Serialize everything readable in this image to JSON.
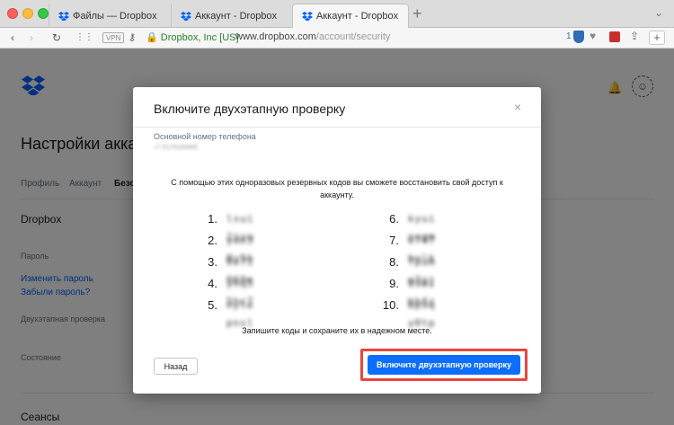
{
  "browser": {
    "tabs": [
      {
        "title": "Файлы — Dropbox"
      },
      {
        "title": "Аккаунт - Dropbox"
      },
      {
        "title": "Аккаунт - Dropbox"
      }
    ],
    "new_tab": "+",
    "vpn": "VPN",
    "site_identity": "Dropbox, Inc [US]",
    "url_domain": "www.dropbox.com",
    "url_path": "/account/security",
    "extension_count": "1"
  },
  "page": {
    "title": "Настройки аккаунт",
    "tabs": [
      "Профиль",
      "Аккаунт",
      "Безо"
    ],
    "section_dropbox": "Dropbox",
    "password_label": "Пароль",
    "change_password": "Изменить пароль",
    "forgot_password": "Забыли пароль?",
    "two_step_label": "Двухэтапная проверка",
    "state_label": "Состояние",
    "sessions_title": "Сеансы"
  },
  "modal": {
    "title": "Включите двухэтапную проверку",
    "close": "×",
    "phone_label": "Основной номер телефона",
    "phone_value": "+7 9176330865",
    "intro": "С помощью этих одноразовых резервных кодов вы сможете восстановить свой доступ к аккаунту.",
    "codes_left": [
      {
        "num": "1.",
        "code": "lsui 2iyu"
      },
      {
        "num": "2.",
        "code": "ydn3 0y5b"
      },
      {
        "num": "3.",
        "code": "0v7i 060e"
      },
      {
        "num": "4.",
        "code": "yhq5 5hc7"
      },
      {
        "num": "5.",
        "code": "nyle pnsl"
      }
    ],
    "codes_right": [
      {
        "num": "6.",
        "code": "kyui ovgm"
      },
      {
        "num": "7.",
        "code": "e747 holk"
      },
      {
        "num": "8.",
        "code": "fpum u2gj"
      },
      {
        "num": "9.",
        "code": "83ei bbfz"
      },
      {
        "num": "10.",
        "code": "bp9q y0tp"
      }
    ],
    "note": "Запишите коды и сохраните их в надежном месте.",
    "back_button": "Назад",
    "enable_button": "Включите двухэтапную проверку"
  },
  "colors": {
    "accent": "#0d6efd",
    "highlight": "#e8463f",
    "overlay": "#000000"
  }
}
